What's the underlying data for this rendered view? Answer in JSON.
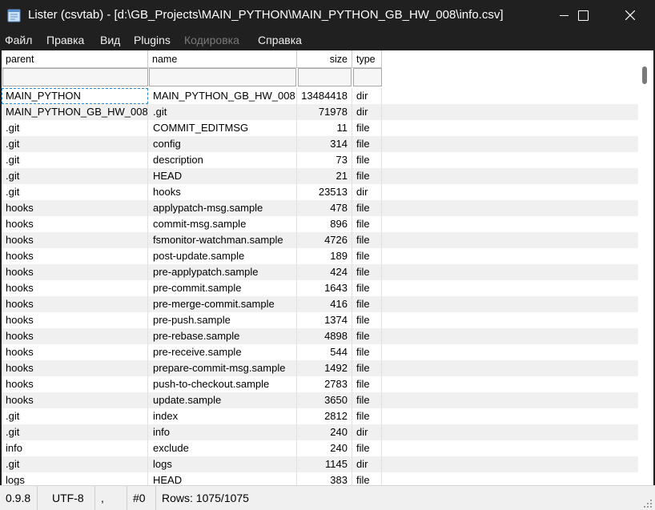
{
  "window": {
    "title": "Lister (csvtab) - [d:\\GB_Projects\\MAIN_PYTHON\\MAIN_PYTHON_GB_HW_008\\info.csv]"
  },
  "menu": {
    "file": "Файл",
    "edit": "Правка",
    "view": "Вид",
    "plugins": "Plugins",
    "encoding": "Кодировка",
    "help": "Справка"
  },
  "columns": {
    "parent": "parent",
    "name": "name",
    "size": "size",
    "type": "type"
  },
  "rows": [
    {
      "parent": "MAIN_PYTHON",
      "name": "MAIN_PYTHON_GB_HW_008",
      "size": "13484418",
      "type": "dir"
    },
    {
      "parent": "MAIN_PYTHON_GB_HW_008",
      "name": ".git",
      "size": "71978",
      "type": "dir"
    },
    {
      "parent": ".git",
      "name": "COMMIT_EDITMSG",
      "size": "11",
      "type": "file"
    },
    {
      "parent": ".git",
      "name": "config",
      "size": "314",
      "type": "file"
    },
    {
      "parent": ".git",
      "name": "description",
      "size": "73",
      "type": "file"
    },
    {
      "parent": ".git",
      "name": "HEAD",
      "size": "21",
      "type": "file"
    },
    {
      "parent": ".git",
      "name": "hooks",
      "size": "23513",
      "type": "dir"
    },
    {
      "parent": "hooks",
      "name": "applypatch-msg.sample",
      "size": "478",
      "type": "file"
    },
    {
      "parent": "hooks",
      "name": "commit-msg.sample",
      "size": "896",
      "type": "file"
    },
    {
      "parent": "hooks",
      "name": "fsmonitor-watchman.sample",
      "size": "4726",
      "type": "file"
    },
    {
      "parent": "hooks",
      "name": "post-update.sample",
      "size": "189",
      "type": "file"
    },
    {
      "parent": "hooks",
      "name": "pre-applypatch.sample",
      "size": "424",
      "type": "file"
    },
    {
      "parent": "hooks",
      "name": "pre-commit.sample",
      "size": "1643",
      "type": "file"
    },
    {
      "parent": "hooks",
      "name": "pre-merge-commit.sample",
      "size": "416",
      "type": "file"
    },
    {
      "parent": "hooks",
      "name": "pre-push.sample",
      "size": "1374",
      "type": "file"
    },
    {
      "parent": "hooks",
      "name": "pre-rebase.sample",
      "size": "4898",
      "type": "file"
    },
    {
      "parent": "hooks",
      "name": "pre-receive.sample",
      "size": "544",
      "type": "file"
    },
    {
      "parent": "hooks",
      "name": "prepare-commit-msg.sample",
      "size": "1492",
      "type": "file"
    },
    {
      "parent": "hooks",
      "name": "push-to-checkout.sample",
      "size": "2783",
      "type": "file"
    },
    {
      "parent": "hooks",
      "name": "update.sample",
      "size": "3650",
      "type": "file"
    },
    {
      "parent": ".git",
      "name": "index",
      "size": "2812",
      "type": "file"
    },
    {
      "parent": ".git",
      "name": "info",
      "size": "240",
      "type": "dir"
    },
    {
      "parent": "info",
      "name": "exclude",
      "size": "240",
      "type": "file"
    },
    {
      "parent": ".git",
      "name": "logs",
      "size": "1145",
      "type": "dir"
    },
    {
      "parent": "logs",
      "name": "HEAD",
      "size": "383",
      "type": "file"
    }
  ],
  "status": {
    "version": "0.9.8",
    "encoding": "UTF-8",
    "delimiter": ",",
    "column": "#0",
    "rows": "Rows: 1075/1075"
  },
  "colors": {
    "titlebar": "#202020",
    "row_alt": "#f0f0f0",
    "focus_outline": "#2a8bd6"
  },
  "icons": [
    "app-notepad-icon",
    "minimize-icon",
    "maximize-icon",
    "close-icon",
    "resize-grip-icon"
  ]
}
